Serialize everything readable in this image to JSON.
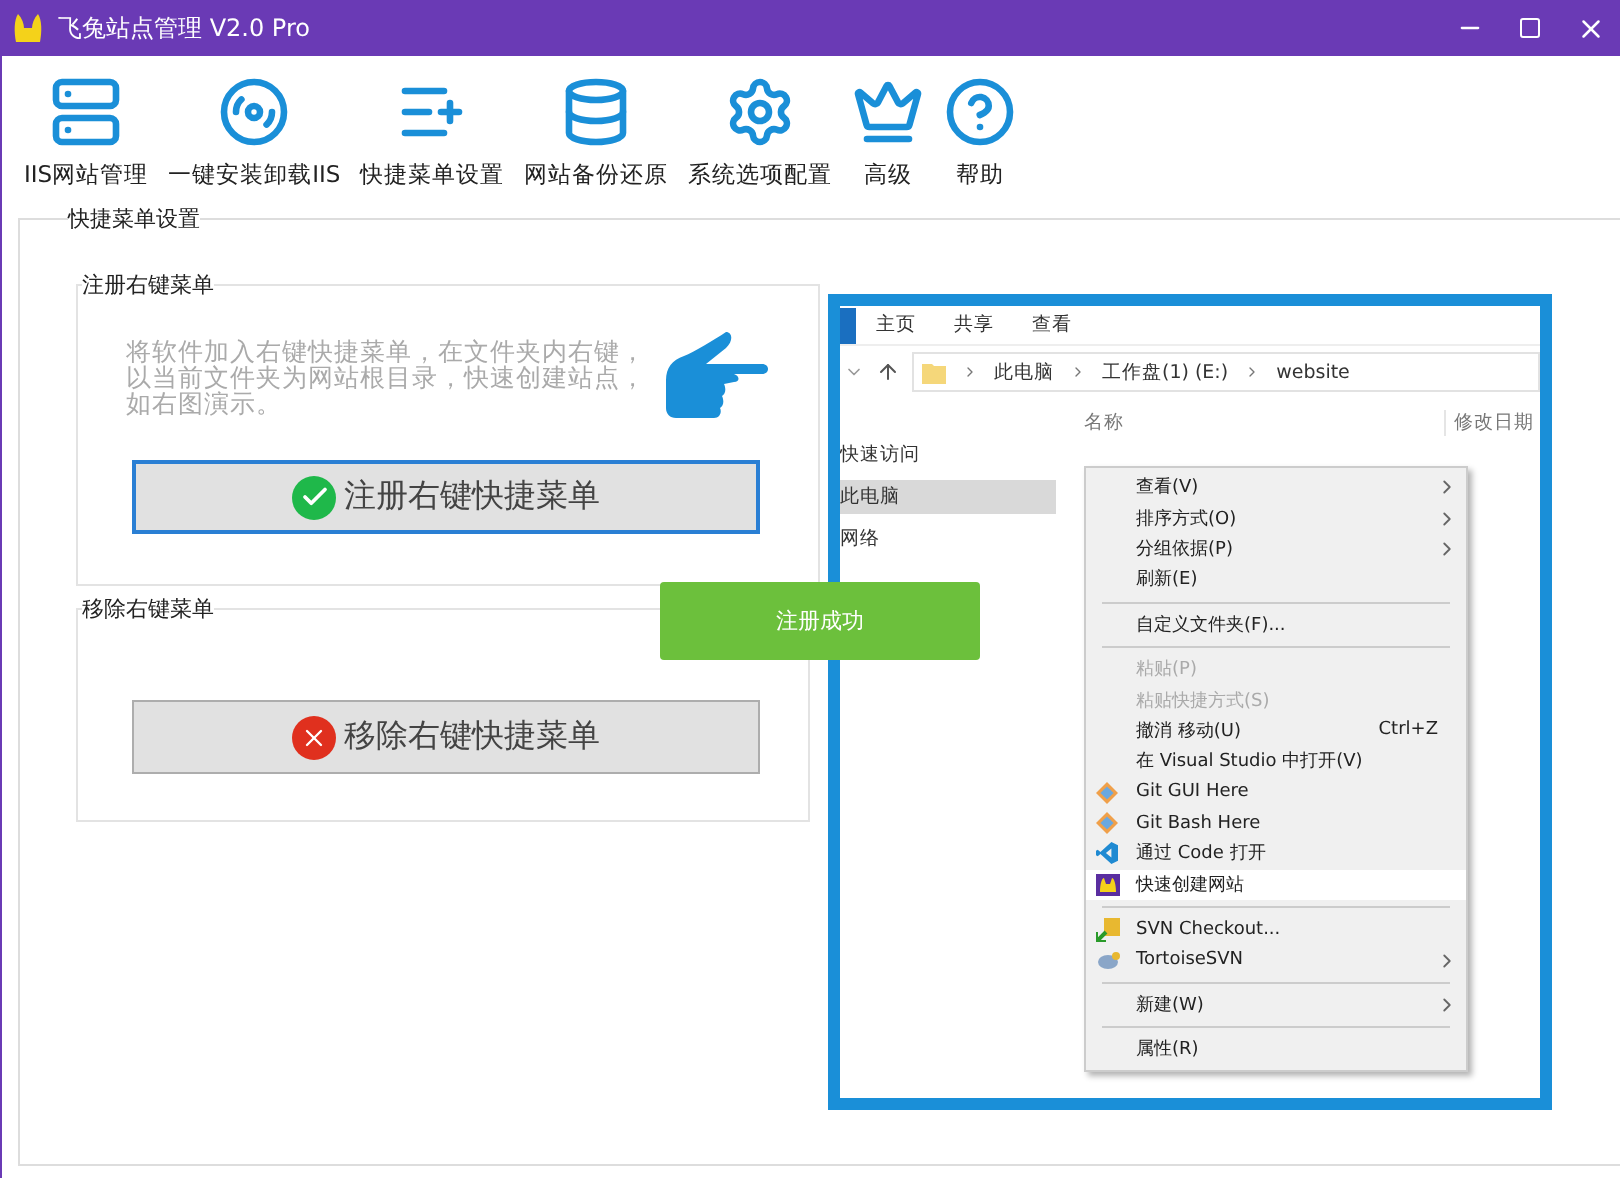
{
  "window": {
    "title": "飞兔站点管理  V2.0 Pro"
  },
  "toolbar": [
    {
      "label": "IIS网站管理"
    },
    {
      "label": "一键安装卸载IIS"
    },
    {
      "label": "快捷菜单设置"
    },
    {
      "label": "网站备份还原"
    },
    {
      "label": "系统选项配置"
    },
    {
      "label": "高级"
    },
    {
      "label": "帮助"
    }
  ],
  "section": {
    "title": "快捷菜单设置"
  },
  "register_group": {
    "title": "注册右键菜单",
    "description": "将软件加入右键快捷菜单，在文件夹内右键，以当前文件夹为网站根目录，快速创建站点，如右图演示。",
    "button": "注册右键快捷菜单"
  },
  "remove_group": {
    "title": "移除右键菜单",
    "button": "移除右键快捷菜单"
  },
  "toast": {
    "text": "注册成功"
  },
  "demo": {
    "ribbon_tabs": [
      "主页",
      "共享",
      "查看"
    ],
    "breadcrumb": [
      "此电脑",
      "工作盘(1) (E:)",
      "website"
    ],
    "columns": [
      "名称",
      "修改日期"
    ],
    "nav": [
      {
        "label": "快速访问",
        "selected": false
      },
      {
        "label": "此电脑",
        "selected": true
      },
      {
        "label": "网络",
        "selected": false
      }
    ],
    "menu": [
      {
        "kind": "item",
        "label": "查看(V)",
        "submenu": true,
        "disabled": false,
        "selected": false
      },
      {
        "kind": "item",
        "label": "排序方式(O)",
        "submenu": true,
        "disabled": false,
        "selected": false
      },
      {
        "kind": "item",
        "label": "分组依据(P)",
        "submenu": true,
        "disabled": false,
        "selected": false
      },
      {
        "kind": "item",
        "label": "刷新(E)",
        "submenu": false,
        "disabled": false,
        "selected": false
      },
      {
        "kind": "separator"
      },
      {
        "kind": "item",
        "label": "自定义文件夹(F)...",
        "submenu": false,
        "disabled": false,
        "selected": false
      },
      {
        "kind": "separator"
      },
      {
        "kind": "item",
        "label": "粘贴(P)",
        "submenu": false,
        "disabled": true,
        "selected": false
      },
      {
        "kind": "item",
        "label": "粘贴快捷方式(S)",
        "submenu": false,
        "disabled": true,
        "selected": false
      },
      {
        "kind": "item",
        "label": "撤消 移动(U)",
        "shortcut": "Ctrl+Z",
        "submenu": false,
        "disabled": false,
        "selected": false
      },
      {
        "kind": "item",
        "label": "在 Visual Studio 中打开(V)",
        "submenu": false,
        "disabled": false,
        "selected": false
      },
      {
        "kind": "git",
        "label": "Git GUI Here",
        "submenu": false,
        "disabled": false,
        "selected": false
      },
      {
        "kind": "git",
        "label": "Git Bash Here",
        "submenu": false,
        "disabled": false,
        "selected": false
      },
      {
        "kind": "editor",
        "label": "通过 Code 打开",
        "submenu": false,
        "disabled": false,
        "selected": false
      },
      {
        "kind": "app",
        "label": "快速创建网站",
        "submenu": false,
        "disabled": false,
        "selected": true
      },
      {
        "kind": "separator"
      },
      {
        "kind": "svn",
        "label": "SVN Checkout...",
        "submenu": false,
        "disabled": false,
        "selected": false
      },
      {
        "kind": "tortoise",
        "label": "TortoiseSVN",
        "submenu": true,
        "disabled": false,
        "selected": false
      },
      {
        "kind": "separator"
      },
      {
        "kind": "item",
        "label": "新建(W)",
        "submenu": true,
        "disabled": false,
        "selected": false
      },
      {
        "kind": "separator"
      },
      {
        "kind": "item",
        "label": "属性(R)",
        "submenu": false,
        "disabled": false,
        "selected": false
      }
    ]
  }
}
